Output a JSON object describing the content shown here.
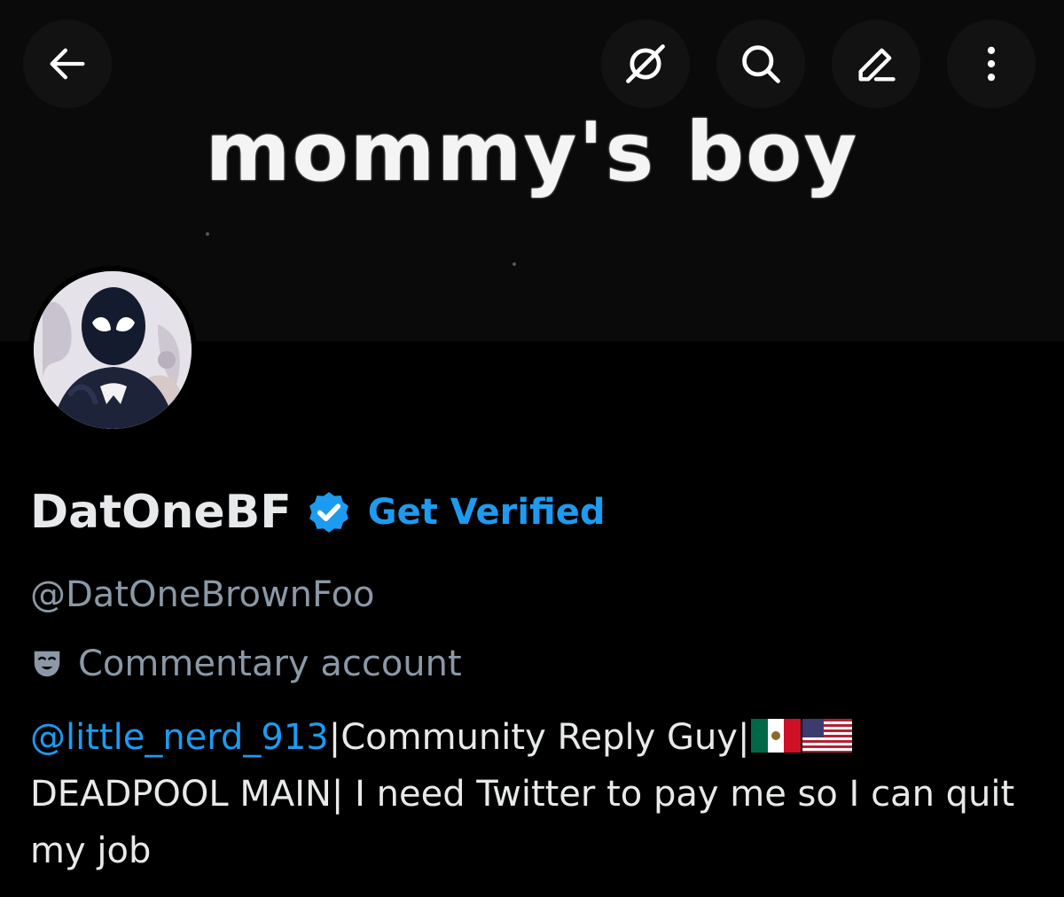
{
  "banner": {
    "text": "mommy's boy",
    "background": "#0a0a0a"
  },
  "toolbar": {
    "back_icon": "arrow-left-icon",
    "grok_icon": "grok-icon",
    "search_icon": "search-icon",
    "edit_icon": "pencil-icon",
    "more_icon": "more-vertical-icon"
  },
  "profile": {
    "display_name": "DatOneBF",
    "verified_icon": "verified-badge-icon",
    "get_verified_label": "Get Verified",
    "handle": "@DatOneBrownFoo",
    "account_label_icon": "theater-masks-icon",
    "account_label": "Commentary account",
    "bio": {
      "mention": "@little_nerd_913",
      "part1": "|Community Reply Guy|",
      "flags": [
        "flag-mexico-icon",
        "flag-usa-icon"
      ],
      "part2": "DEADPOOL MAIN| I need Twitter to pay me so I can quit my job"
    }
  },
  "colors": {
    "accent": "#1d9bf0",
    "text_primary": "#e7e9ea",
    "text_secondary": "#8b98a5",
    "background": "#000000"
  }
}
